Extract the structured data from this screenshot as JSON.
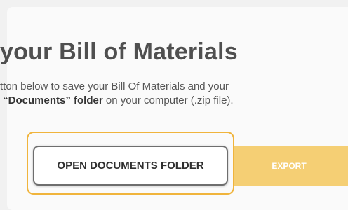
{
  "dialog": {
    "title": "your Bill of Materials",
    "desc_line1": "tton below to save your Bill Of Materials and your",
    "desc_line2_bold": "“Documents” folder",
    "desc_line2_rest": " on your computer (.zip file)."
  },
  "buttons": {
    "open_documents": "OPEN DOCUMENTS FOLDER",
    "export": "EXPORT"
  },
  "colors": {
    "accent": "#f0b43c",
    "export_bg": "#f5cf74"
  }
}
